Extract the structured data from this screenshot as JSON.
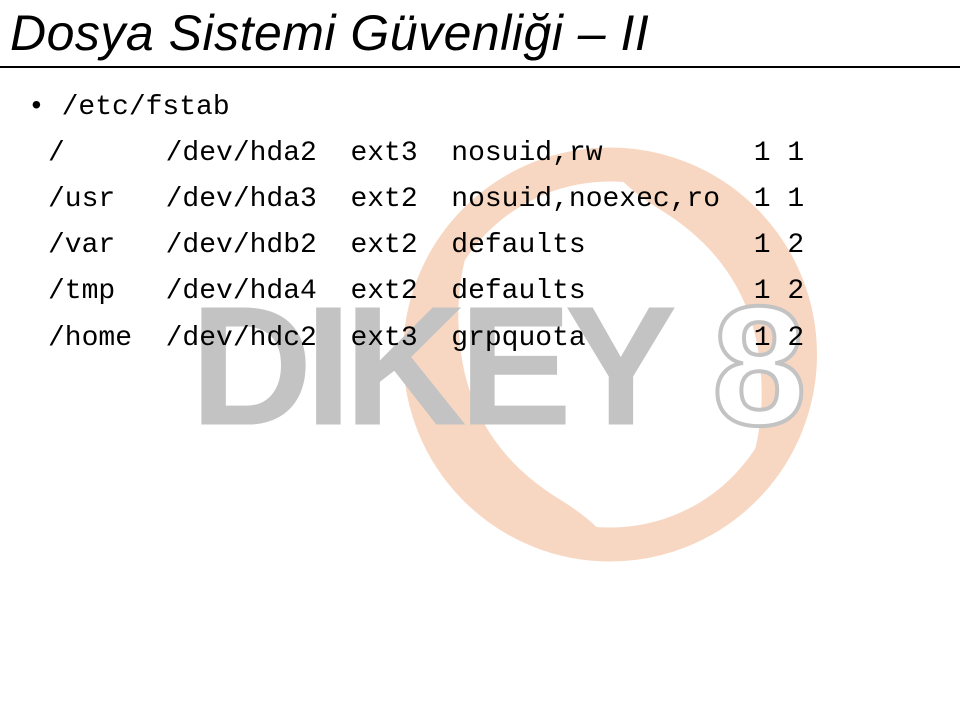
{
  "title": "Dosya Sistemi Güvenliği – II",
  "bullet_label": "/etc/fstab",
  "fstab": {
    "rows": [
      {
        "mount": "/",
        "device": "/dev/hda2",
        "fs": "ext3",
        "opts": "nosuid,rw",
        "d": "1",
        "p": "1"
      },
      {
        "mount": "/usr",
        "device": "/dev/hda3",
        "fs": "ext2",
        "opts": "nosuid,noexec,ro",
        "d": "1",
        "p": "1"
      },
      {
        "mount": "/var",
        "device": "/dev/hdb2",
        "fs": "ext2",
        "opts": "defaults",
        "d": "1",
        "p": "2"
      },
      {
        "mount": "/tmp",
        "device": "/dev/hda4",
        "fs": "ext2",
        "opts": "defaults",
        "d": "1",
        "p": "2"
      },
      {
        "mount": "/home",
        "device": "/dev/hdc2",
        "fs": "ext3",
        "opts": "grpquota",
        "d": "1",
        "p": "2"
      }
    ]
  },
  "watermark_text": "DIKEY8"
}
